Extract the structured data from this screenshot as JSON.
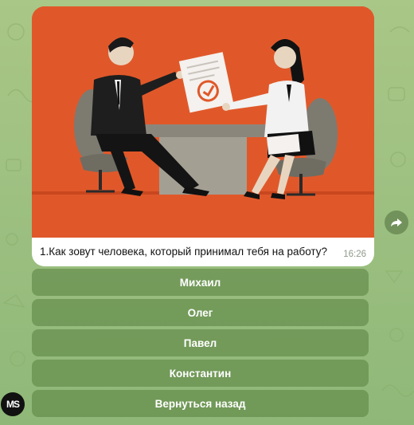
{
  "chat": {
    "caption": "1.Как зовут человека, который принимал тебя на работу?",
    "time": "16:26"
  },
  "keyboard": {
    "buttons": [
      "Михаил",
      "Олег",
      "Павел",
      "Константин",
      "Вернуться назад"
    ]
  },
  "avatar": {
    "initials": "МS"
  },
  "icons": {
    "share": "share-arrow-icon"
  },
  "colors": {
    "illustration_bg": "#e0582a",
    "button_bg": "#6b9450",
    "bubble": "#ffffff"
  }
}
